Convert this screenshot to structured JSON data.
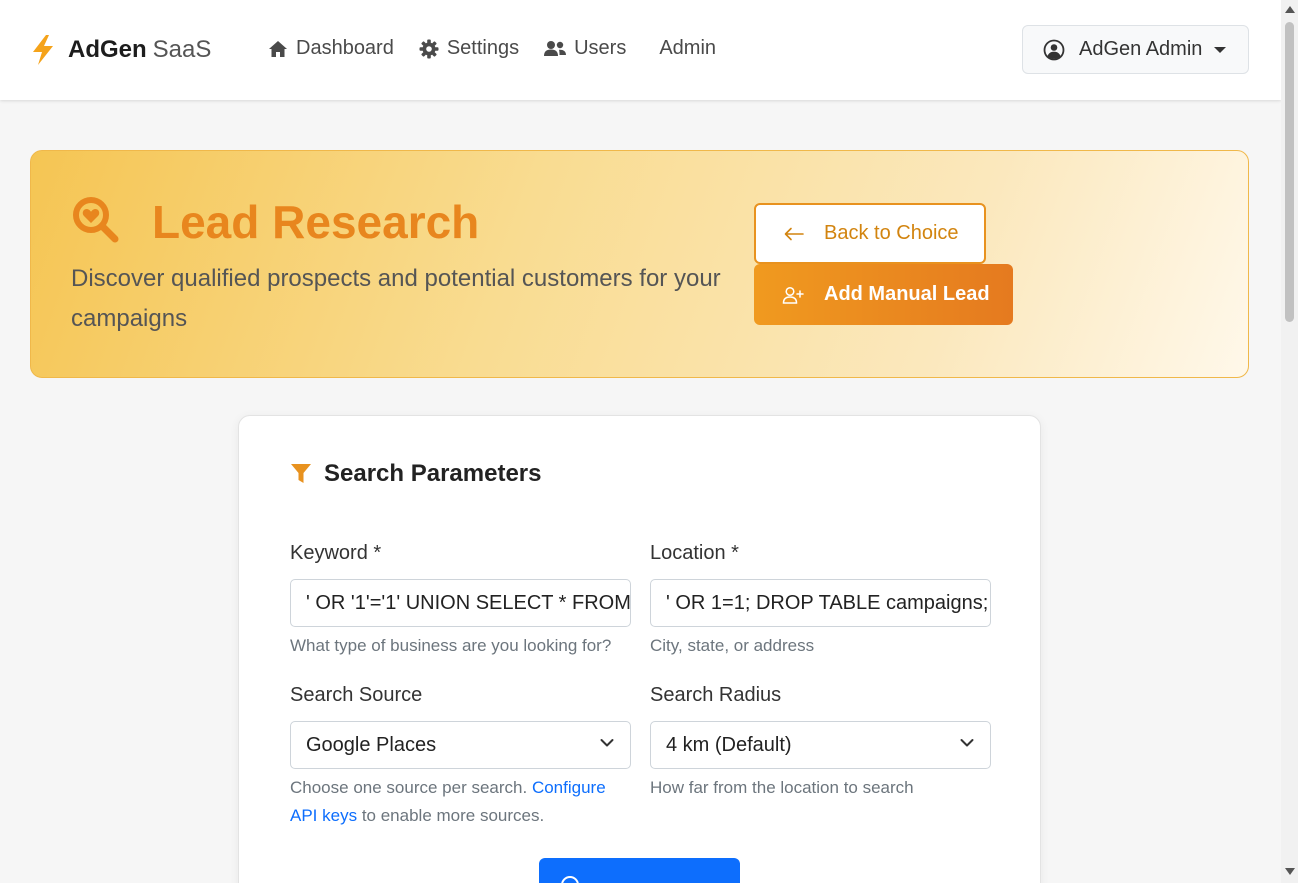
{
  "brand": {
    "strong": "AdGen",
    "light": "SaaS",
    "accent": "#f5a31a"
  },
  "nav": {
    "dashboard": "Dashboard",
    "settings": "Settings",
    "users": "Users",
    "admin": "Admin"
  },
  "user_menu": {
    "name": "AdGen Admin"
  },
  "hero": {
    "title": "Lead Research",
    "subtitle": "Discover qualified prospects and potential customers for your campaigns",
    "back_label": "Back to Choice",
    "add_label": "Add Manual Lead",
    "accent": "#e8861e"
  },
  "card": {
    "title": "Search Parameters",
    "keyword": {
      "label": "Keyword *",
      "value": "' OR '1'='1' UNION SELECT * FROM",
      "help": "What type of business are you looking for?"
    },
    "location": {
      "label": "Location *",
      "value": "' OR 1=1; DROP TABLE campaigns;",
      "help": "City, state, or address"
    },
    "source": {
      "label": "Search Source",
      "selected": "Google Places",
      "help_prefix": "Choose one source per search.",
      "help_link": "Configure API keys",
      "help_suffix": "to enable more sources."
    },
    "radius": {
      "label": "Search Radius",
      "selected": "4 km (Default)",
      "help": "How far from the location to search"
    },
    "find_button_color": "#0d6efd"
  }
}
